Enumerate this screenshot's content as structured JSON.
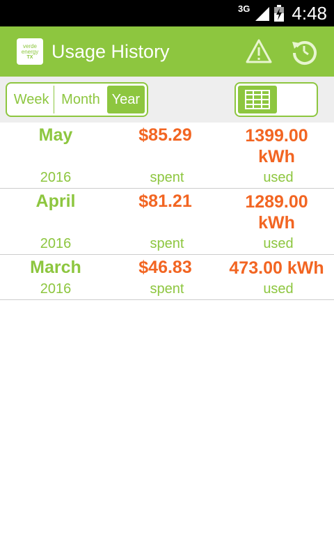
{
  "status_bar": {
    "network": "3G",
    "time": "4:48"
  },
  "action_bar": {
    "logo_lines": [
      "verde",
      "energy",
      "TX"
    ],
    "title": "Usage History",
    "background_color": "#8dc63f"
  },
  "period_selector": {
    "options": [
      "Week",
      "Month",
      "Year"
    ],
    "selected": "Year"
  },
  "view_toggle": {
    "icon": "grid-icon",
    "state": "table"
  },
  "history": [
    {
      "month": "May",
      "year": "2016",
      "spent": "$85.29",
      "spent_label": "spent",
      "used_line1": "1399.00",
      "used_line2": "kWh",
      "used_label": "used"
    },
    {
      "month": "April",
      "year": "2016",
      "spent": "$81.21",
      "spent_label": "spent",
      "used_line1": "1289.00",
      "used_line2": "kWh",
      "used_label": "used"
    },
    {
      "month": "March",
      "year": "2016",
      "spent": "$46.83",
      "spent_label": "spent",
      "used_line1": "473.00 kWh",
      "used_line2": "",
      "used_label": "used"
    }
  ],
  "colors": {
    "accent": "#8dc63f",
    "value": "#f26522"
  }
}
